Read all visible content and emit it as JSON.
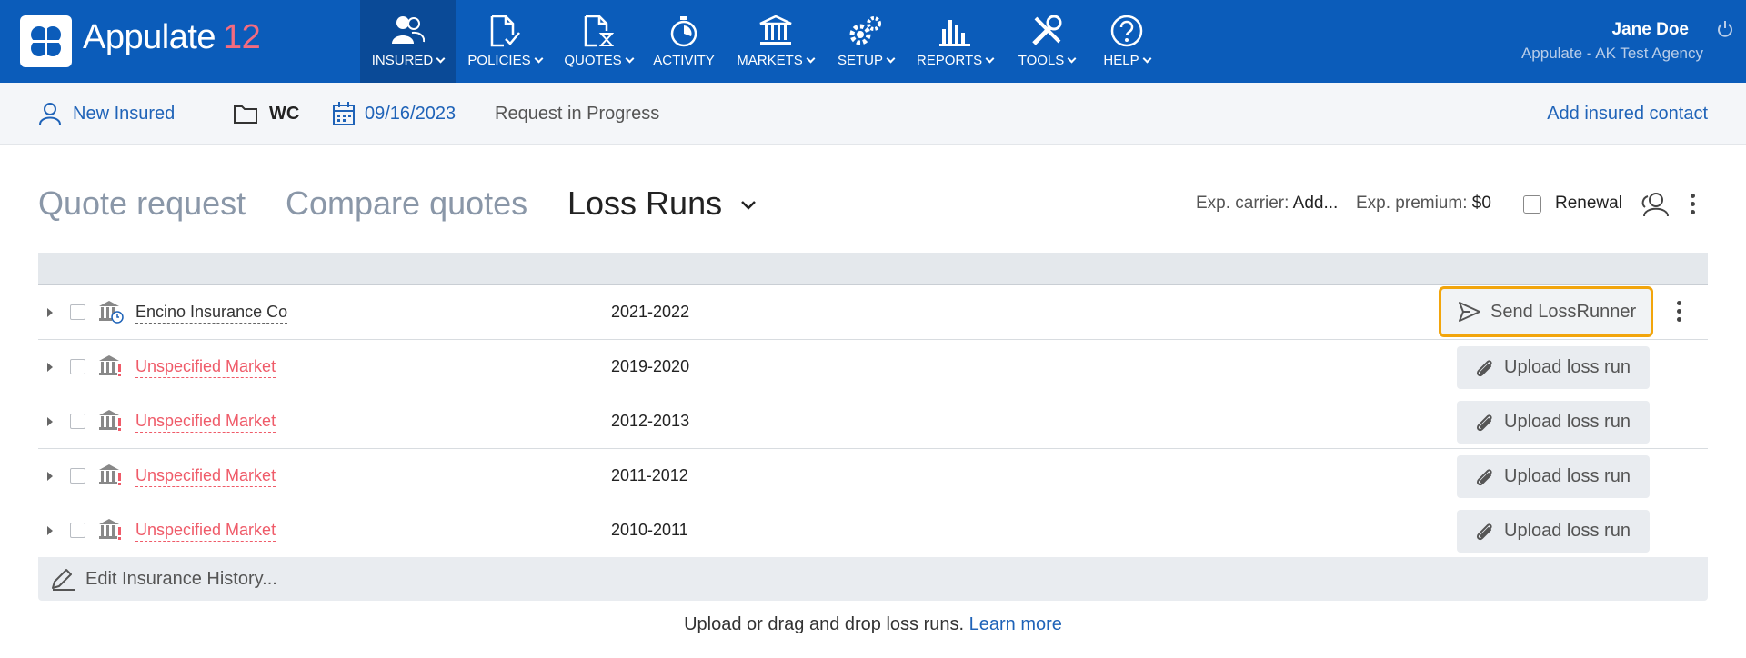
{
  "app": {
    "name": "Appulate",
    "version": "12"
  },
  "nav": {
    "items": [
      {
        "label": "INSURED",
        "icon": "insured-icon"
      },
      {
        "label": "POLICIES",
        "icon": "policies-icon"
      },
      {
        "label": "QUOTES",
        "icon": "quotes-icon"
      },
      {
        "label": "ACTIVITY",
        "icon": "activity-icon"
      },
      {
        "label": "MARKETS",
        "icon": "markets-icon"
      },
      {
        "label": "SETUP",
        "icon": "setup-icon"
      },
      {
        "label": "REPORTS",
        "icon": "reports-icon"
      },
      {
        "label": "TOOLS",
        "icon": "tools-icon"
      },
      {
        "label": "HELP",
        "icon": "help-icon"
      }
    ]
  },
  "user": {
    "name": "Jane Doe",
    "agency": "Appulate - AK Test Agency"
  },
  "subbar": {
    "new_insured": "New Insured",
    "line": "WC",
    "date": "09/16/2023",
    "status": "Request in Progress",
    "add_contact": "Add insured contact"
  },
  "tabs": {
    "quote_request": "Quote request",
    "compare_quotes": "Compare quotes",
    "loss_runs": "Loss Runs"
  },
  "header": {
    "exp_carrier_label": "Exp. carrier:",
    "exp_carrier_value": "Add...",
    "exp_premium_label": "Exp. premium:",
    "exp_premium_value": "$0",
    "renewal_label": "Renewal"
  },
  "rows": [
    {
      "market": "Encino Insurance Co",
      "term": "2021-2022",
      "action": "Send LossRunner"
    },
    {
      "market": "Unspecified Market",
      "term": "2019-2020",
      "action": "Upload loss run"
    },
    {
      "market": "Unspecified Market",
      "term": "2012-2013",
      "action": "Upload loss run"
    },
    {
      "market": "Unspecified Market",
      "term": "2011-2012",
      "action": "Upload loss run"
    },
    {
      "market": "Unspecified Market",
      "term": "2010-2011",
      "action": "Upload loss run"
    }
  ],
  "footer": {
    "edit_history": "Edit Insurance History...",
    "upload_hint": "Upload or drag and drop loss runs.",
    "learn_more": "Learn more"
  },
  "colors": {
    "nav_bg": "#0b5cba",
    "accent_blue": "#1f63b8",
    "brand_version": "#f36b7f",
    "unspecified_red": "#ef5b69",
    "highlight_orange": "#f2a50c"
  }
}
